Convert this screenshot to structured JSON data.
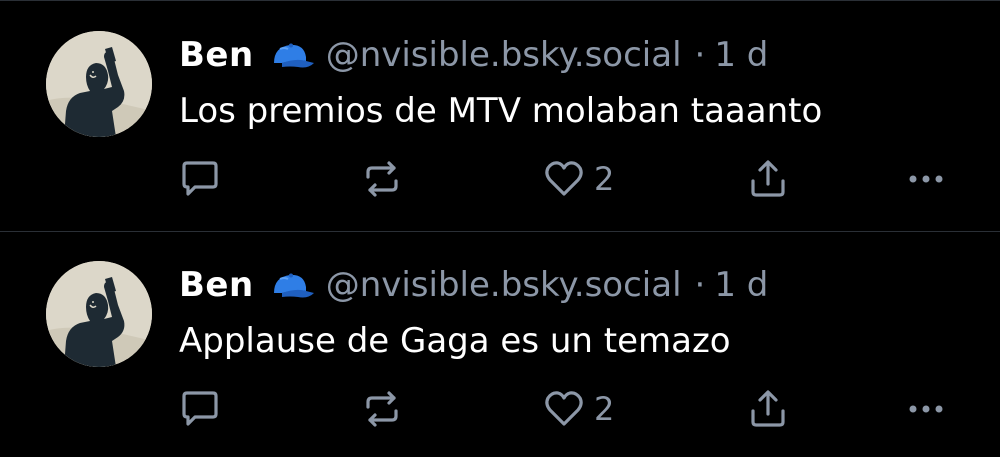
{
  "feed": {
    "posts": [
      {
        "author": {
          "name": "Ben",
          "badge_icon": "blue-cap-icon",
          "handle": "@nvisible.bsky.social"
        },
        "separator": "·",
        "time": "1 d",
        "text": "Los premios de MTV molaban taaanto",
        "likes": "2",
        "actions": [
          "reply-icon",
          "repost-icon",
          "like-heart-icon",
          "share-icon",
          "more-options-icon"
        ]
      },
      {
        "author": {
          "name": "Ben",
          "badge_icon": "blue-cap-icon",
          "handle": "@nvisible.bsky.social"
        },
        "separator": "·",
        "time": "1 d",
        "text": "Applause de Gaga es un temazo",
        "likes": "2",
        "actions": [
          "reply-icon",
          "repost-icon",
          "like-heart-icon",
          "share-icon",
          "more-options-icon"
        ]
      }
    ]
  },
  "colors": {
    "background": "#000000",
    "primary_text": "#ffffff",
    "secondary_text": "#8c97a7",
    "divider": "#2a2f36",
    "cap_blue": "#2f7ee6"
  }
}
